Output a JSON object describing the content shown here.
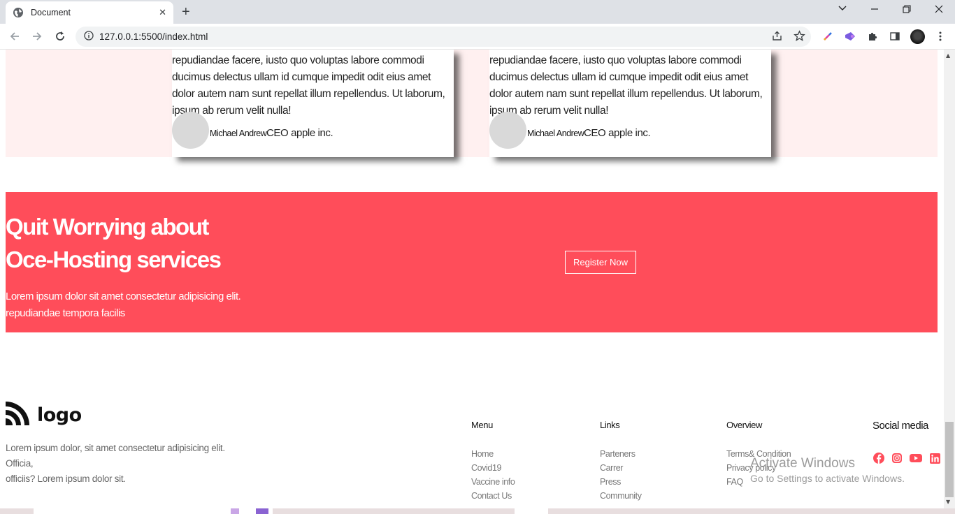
{
  "browser": {
    "tab_title": "Document",
    "url": "127.0.0.1:5500/index.html"
  },
  "testimonials": [
    {
      "quote": "repudiandae facere, iusto quo voluptas labore commodi ducimus delectus ullam id cumque impedit odit eius amet dolor autem nam sunt repellat illum repellendus. Ut laborum, ipsum ab rerum velit nulla!",
      "name": "Michael Andrew",
      "role": "CEO apple inc."
    },
    {
      "quote": "repudiandae facere, iusto quo voluptas labore commodi ducimus delectus ullam id cumque impedit odit eius amet dolor autem nam sunt repellat illum repellendus. Ut laborum, ipsum ab rerum velit nulla!",
      "name": "Michael Andrew",
      "role": "CEO apple inc."
    }
  ],
  "cta": {
    "heading_line1": "Quit Worrying about",
    "heading_line2": "Oce-Hosting services",
    "desc_line1": "Lorem ipsum dolor sit amet consectetur adipisicing elit.",
    "desc_line2": "repudiandae tempora facilis",
    "button": "Register Now",
    "color": "#ff4d5a"
  },
  "footer": {
    "logo_text": "logo",
    "about_line1": "Lorem ipsum dolor, sit amet consectetur adipisicing elit. Officia,",
    "about_line2": "officiis? Lorem ipsum dolor sit.",
    "menu": {
      "title": "Menu",
      "links": [
        "Home",
        "Covid19",
        "Vaccine info",
        "Contact Us"
      ]
    },
    "links": {
      "title": "Links",
      "links": [
        "Parteners",
        "Carrer",
        "Press",
        "Community"
      ]
    },
    "overview": {
      "title": "Overview",
      "links": [
        "Terms& Condition",
        "Privacy policy",
        "FAQ"
      ]
    },
    "social": {
      "title": "Social media",
      "icons": [
        "facebook-icon",
        "instagram-icon",
        "youtube-icon",
        "linkedin-icon"
      ],
      "color": "#ff4d5a"
    }
  },
  "watermark": {
    "line1": "Activate Windows",
    "line2": "Go to Settings to activate Windows."
  }
}
